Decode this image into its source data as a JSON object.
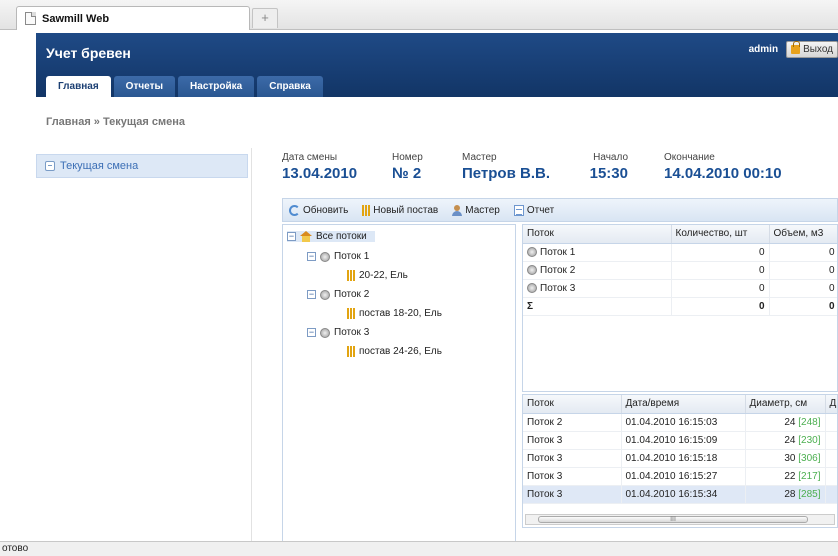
{
  "browser": {
    "tab_title": "Sawmill Web",
    "new_tab": "+"
  },
  "app": {
    "title": "Учет бревен",
    "user": "admin",
    "logout_label": "Выход",
    "tabs": [
      "Главная",
      "Отчеты",
      "Настройка",
      "Справка"
    ]
  },
  "breadcrumb": "Главная » Текущая смена",
  "sidebar": {
    "items": [
      {
        "label": "Текущая смена"
      }
    ]
  },
  "shift": {
    "date_label": "Дата смены",
    "date": "13.04.2010",
    "number_label": "Номер",
    "number": "№ 2",
    "master_label": "Мастер",
    "master": "Петров В.В.",
    "start_label": "Начало",
    "start": "15:30",
    "end_label": "Окончание",
    "end": "14.04.2010 00:10"
  },
  "toolbar": {
    "refresh": "Обновить",
    "new_post": "Новый постав",
    "master": "Мастер",
    "report": "Отчет"
  },
  "tree": {
    "root": "Все потоки",
    "streams": [
      {
        "label": "Поток 1",
        "child": "20-22, Ель"
      },
      {
        "label": "Поток 2",
        "child": "постав 18-20, Ель"
      },
      {
        "label": "Поток 3",
        "child": "постав 24-26, Ель"
      }
    ]
  },
  "summary_grid": {
    "headers": [
      "Поток",
      "Количество, шт",
      "Объем, м3"
    ],
    "rows": [
      [
        "Поток 1",
        "0",
        "0"
      ],
      [
        "Поток 2",
        "0",
        "0"
      ],
      [
        "Поток 3",
        "0",
        "0"
      ]
    ],
    "sum_row": [
      "Σ",
      "0",
      "0"
    ]
  },
  "log_grid": {
    "headers": [
      "Поток",
      "Дата/время",
      "Диаметр, см",
      "Д"
    ],
    "rows": [
      [
        "Поток 2",
        "01.04.2010 16:15:03",
        "24",
        "[248]"
      ],
      [
        "Поток 3",
        "01.04.2010 16:15:09",
        "24",
        "[230]"
      ],
      [
        "Поток 3",
        "01.04.2010 16:15:18",
        "30",
        "[306]"
      ],
      [
        "Поток 3",
        "01.04.2010 16:15:27",
        "22",
        "[217]"
      ],
      [
        "Поток 3",
        "01.04.2010 16:15:34",
        "28",
        "[285]"
      ]
    ],
    "scroll_grip": "III"
  },
  "statusbar": {
    "text": "отово"
  },
  "colors": {
    "header_bg": "#15396f",
    "accent": "#1a4f94",
    "selection": "#dfe8f6"
  }
}
